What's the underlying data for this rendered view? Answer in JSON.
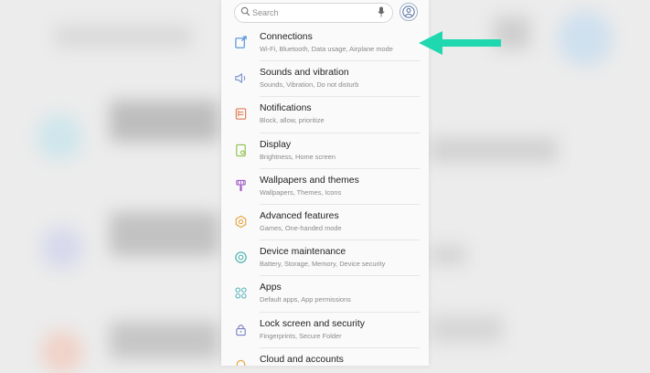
{
  "search": {
    "placeholder": "Search"
  },
  "settings": [
    {
      "title": "Connections",
      "subtitle": "Wi-Fi, Bluetooth, Data usage, Airplane mode",
      "icon": "connections-icon",
      "color": "#4f8fd6"
    },
    {
      "title": "Sounds and vibration",
      "subtitle": "Sounds, Vibration, Do not disturb",
      "icon": "speaker-icon",
      "color": "#7a8fd0"
    },
    {
      "title": "Notifications",
      "subtitle": "Block, allow, prioritize",
      "icon": "notifications-icon",
      "color": "#e07a55"
    },
    {
      "title": "Display",
      "subtitle": "Brightness, Home screen",
      "icon": "display-icon",
      "color": "#8cbf4a"
    },
    {
      "title": "Wallpapers and themes",
      "subtitle": "Wallpapers, Themes, Icons",
      "icon": "paintbrush-icon",
      "color": "#a05cc8"
    },
    {
      "title": "Advanced features",
      "subtitle": "Games, One-handed mode",
      "icon": "gear-icon",
      "color": "#e6a23c"
    },
    {
      "title": "Device maintenance",
      "subtitle": "Battery, Storage, Memory, Device security",
      "icon": "maintenance-icon",
      "color": "#3fb0a8"
    },
    {
      "title": "Apps",
      "subtitle": "Default apps, App permissions",
      "icon": "apps-icon",
      "color": "#4fb0b8"
    },
    {
      "title": "Lock screen and security",
      "subtitle": "Fingerprints, Secure Folder",
      "icon": "lock-icon",
      "color": "#7a80c8"
    },
    {
      "title": "Cloud and accounts",
      "subtitle": "",
      "icon": "key-icon",
      "color": "#e6a23c"
    }
  ],
  "colors": {
    "arrow": "#1fd8b0",
    "accent": "#4f6fa8"
  }
}
